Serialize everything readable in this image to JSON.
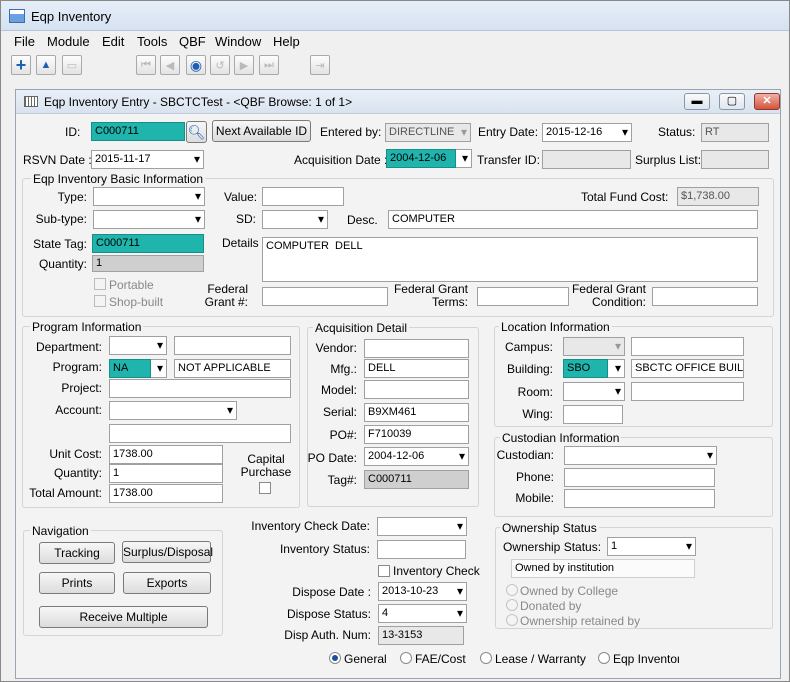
{
  "app": {
    "title": "Eqp Inventory"
  },
  "menu": [
    "File",
    "Module",
    "Edit",
    "Tools",
    "QBF",
    "Window",
    "Help"
  ],
  "toolbar_icons": [
    "add-icon",
    "save-icon",
    "print-icon",
    "first-record-icon",
    "previous-record-icon",
    "browse-icon",
    "undo-icon",
    "next-record-icon",
    "last-record-icon",
    "exit-icon"
  ],
  "form": {
    "title": "Eqp Inventory Entry - SBCTCTest - <QBF Browse: 1 of 1>",
    "header": {
      "id_label": "ID:",
      "id": "C000711",
      "next_id_button": "Next Available ID",
      "entered_by_label": "Entered by:",
      "entered_by": "DIRECTLINE",
      "entry_date_label": "Entry Date:",
      "entry_date": "2015-12-16",
      "status_label": "Status:",
      "status": "RT",
      "rsvn_date_label": "RSVN Date :",
      "rsvn_date": "2015-11-17",
      "acq_date_label": "Acquisition Date :",
      "acq_date": "2004-12-06",
      "transfer_id_label": "Transfer ID:",
      "transfer_id": "",
      "surplus_list_label": "Surplus List:",
      "surplus_list": ""
    },
    "basic": {
      "title": "Eqp Inventory Basic Information",
      "type_label": "Type:",
      "type": "",
      "value_label": "Value:",
      "value": "",
      "total_fund_label": "Total Fund Cost:",
      "total_fund": "$1,738.00",
      "subtype_label": "Sub-type:",
      "subtype": "",
      "sd_label": "SD:",
      "sd": "",
      "desc_label": "Desc.",
      "desc": "COMPUTER",
      "state_tag_label": "State Tag:",
      "state_tag": "C000711",
      "details_label": "Details",
      "details": "COMPUTER  DELL",
      "quantity_label": "Quantity:",
      "quantity": "1",
      "portable_label": "Portable",
      "shop_built_label": "Shop-built",
      "fed_grant_label_1": "Federal",
      "fed_grant_label_2": "Grant #:",
      "fed_grant": "",
      "fed_terms_label_1": "Federal Grant",
      "fed_terms_label_2": "Terms:",
      "fed_terms": "",
      "fed_cond_label_1": "Federal Grant",
      "fed_cond_label_2": "Condition:",
      "fed_cond": ""
    },
    "program": {
      "title": "Program Information",
      "department_label": "Department:",
      "department": "",
      "department_name": "",
      "program_label": "Program:",
      "program": "NA",
      "program_name": "NOT APPLICABLE",
      "project_label": "Project:",
      "project": "",
      "account_label": "Account:",
      "account": "",
      "account_extra": "",
      "unit_cost_label": "Unit Cost:",
      "unit_cost": "1738.00",
      "quantity_label": "Quantity:",
      "quantity": "1",
      "total_label": "Total Amount:",
      "total": "1738.00",
      "capital_label_1": "Capital",
      "capital_label_2": "Purchase"
    },
    "acquisition": {
      "title": "Acquisition Detail",
      "vendor_label": "Vendor:",
      "vendor": "",
      "mfg_label": "Mfg.:",
      "mfg": "DELL",
      "model_label": "Model:",
      "model": "",
      "serial_label": "Serial:",
      "serial": "B9XM461",
      "po_label": "PO#:",
      "po": "F710039",
      "po_date_label": "PO Date:",
      "po_date": "2004-12-06",
      "tag_label": "Tag#:",
      "tag": "C000711"
    },
    "location": {
      "title": "Location Information",
      "campus_label": "Campus:",
      "campus": "",
      "campus_name": "",
      "building_label": "Building:",
      "building": "SBO",
      "building_name": "SBCTC OFFICE BUILDI",
      "room_label": "Room:",
      "room": "",
      "room_name": "",
      "wing_label": "Wing:",
      "wing": ""
    },
    "custodian": {
      "title": "Custodian Information",
      "custodian_label": "Custodian:",
      "custodian": "",
      "phone_label": "Phone:",
      "phone": "",
      "mobile_label": "Mobile:",
      "mobile": ""
    },
    "navigation": {
      "title": "Navigation",
      "tracking": "Tracking",
      "surplus": "Surplus/Disposal",
      "prints": "Prints",
      "exports": "Exports",
      "receive_multiple": "Receive Multiple"
    },
    "inventory": {
      "check_date_label": "Inventory Check Date:",
      "check_date": "",
      "status_label": "Inventory Status:",
      "status": "",
      "check_label": "Inventory Check",
      "dispose_date_label": "Dispose Date :",
      "dispose_date": "2013-10-23",
      "dispose_status_label": "Dispose Status:",
      "dispose_status": "4",
      "disp_auth_label": "Disp Auth. Num:",
      "disp_auth": "13-3153"
    },
    "ownership": {
      "title": "Ownership Status",
      "status_label": "Ownership Status:",
      "status": "1",
      "status_desc": "Owned by institution",
      "owned_college": "Owned by College",
      "donated": "Donated by",
      "retained": "Ownership retained by"
    },
    "tabs": [
      "General",
      "FAE/Cost",
      "Lease / Warranty",
      "Eqp Inventory"
    ]
  }
}
